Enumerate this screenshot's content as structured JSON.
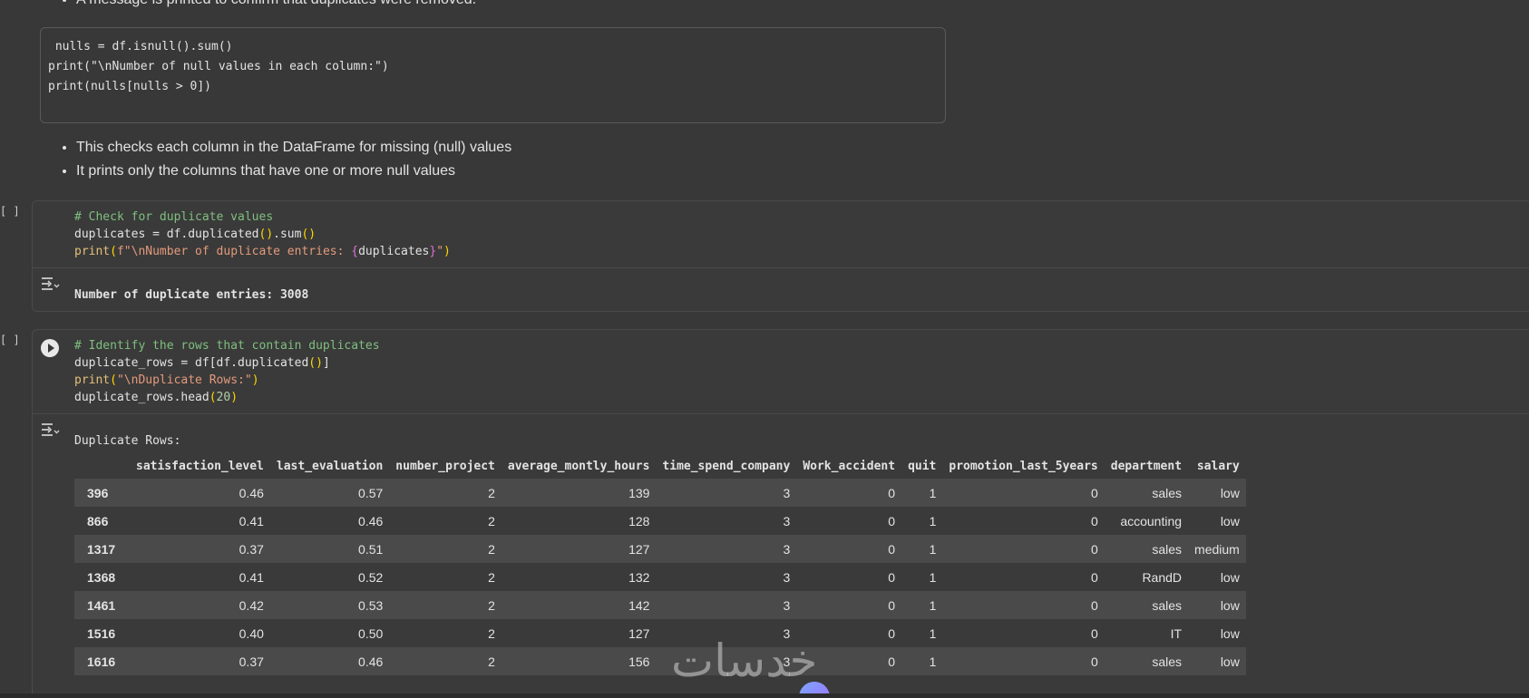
{
  "top_bullet": "A message is printed to confirm that duplicates were removed.",
  "plain_code": [
    " nulls = df.isnull().sum()",
    "print(\"\\nNumber of null values in each column:\")",
    "print(nulls[nulls > 0])"
  ],
  "bullets": [
    "This checks each column in the DataFrame for missing (null) values",
    "It prints only the columns that have one or more null values"
  ],
  "cell1": {
    "exec_count": "[ ]",
    "comment": "# Check for duplicate values",
    "line2_a": "duplicates = df.duplicated",
    "line2_b": ".sum",
    "line3_fn": "print",
    "line3_str_a": "f\"\\nNumber of duplicate entries: ",
    "line3_var": "duplicates",
    "line3_str_b": "\"",
    "output": "Number of duplicate entries: 3008"
  },
  "cell2": {
    "exec_count": "[ ]",
    "comment": "# Identify the rows that contain duplicates",
    "line2_a": "duplicate_rows = df[df.duplicated",
    "line2_b": "]",
    "line3_fn": "print",
    "line3_str": "\"\\nDuplicate Rows:\"",
    "line4_a": "duplicate_rows.head",
    "line4_num": "20",
    "output_title": "Duplicate Rows:"
  },
  "table": {
    "columns": [
      "",
      "satisfaction_level",
      "last_evaluation",
      "number_project",
      "average_montly_hours",
      "time_spend_company",
      "Work_accident",
      "quit",
      "promotion_last_5years",
      "department",
      "salary"
    ],
    "rows": [
      [
        "396",
        "0.46",
        "0.57",
        "2",
        "139",
        "3",
        "0",
        "1",
        "0",
        "sales",
        "low"
      ],
      [
        "866",
        "0.41",
        "0.46",
        "2",
        "128",
        "3",
        "0",
        "1",
        "0",
        "accounting",
        "low"
      ],
      [
        "1317",
        "0.37",
        "0.51",
        "2",
        "127",
        "3",
        "0",
        "1",
        "0",
        "sales",
        "medium"
      ],
      [
        "1368",
        "0.41",
        "0.52",
        "2",
        "132",
        "3",
        "0",
        "1",
        "0",
        "RandD",
        "low"
      ],
      [
        "1461",
        "0.42",
        "0.53",
        "2",
        "142",
        "3",
        "0",
        "1",
        "0",
        "sales",
        "low"
      ],
      [
        "1516",
        "0.40",
        "0.50",
        "2",
        "127",
        "3",
        "0",
        "1",
        "0",
        "IT",
        "low"
      ],
      [
        "1616",
        "0.37",
        "0.46",
        "2",
        "156",
        "3",
        "0",
        "1",
        "0",
        "sales",
        "low"
      ]
    ]
  },
  "watermark": "خدسات"
}
